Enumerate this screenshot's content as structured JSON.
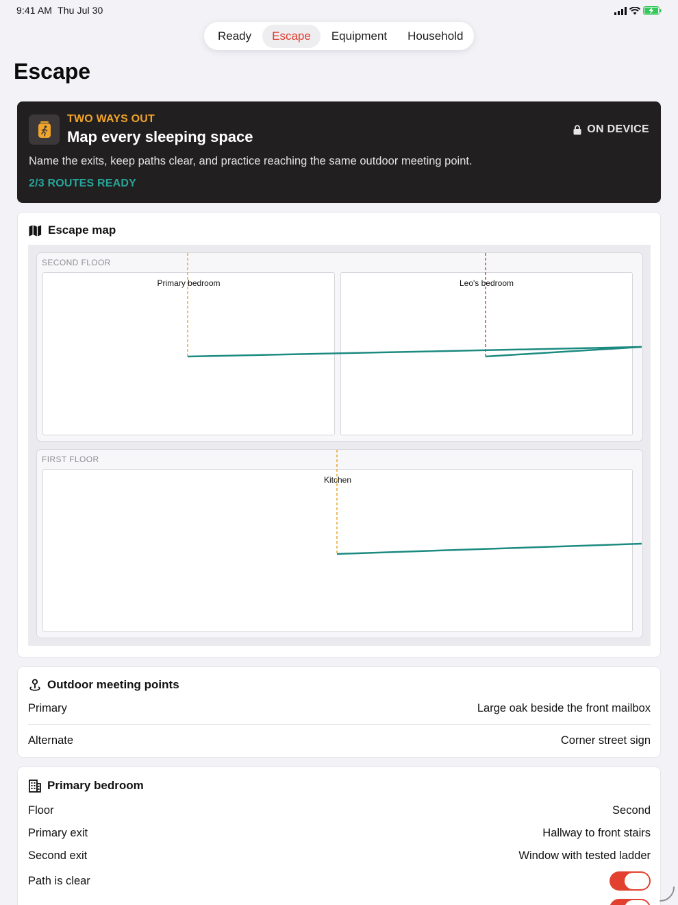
{
  "status": {
    "time": "9:41 AM",
    "date": "Thu Jul 30"
  },
  "tabs": [
    {
      "label": "Ready",
      "active": false
    },
    {
      "label": "Escape",
      "active": true
    },
    {
      "label": "Equipment",
      "active": false
    },
    {
      "label": "Household",
      "active": false
    }
  ],
  "page_title": "Escape",
  "hero": {
    "eyebrow": "TWO WAYS OUT",
    "title": "Map every sleeping space",
    "badge": "ON DEVICE",
    "description": "Name the exits, keep paths clear, and practice reaching the same outdoor meeting point.",
    "status": "2/3 ROUTES READY",
    "icon": "running-person-icon",
    "accent_color": "#f0a42a",
    "status_color": "#26a69a"
  },
  "escape_map": {
    "title": "Escape map",
    "icon": "map-icon",
    "floors": [
      {
        "label": "SECOND FLOOR",
        "rooms": [
          {
            "name": "Primary bedroom"
          },
          {
            "name": "Leo's bedroom"
          }
        ]
      },
      {
        "label": "FIRST FLOOR",
        "rooms": [
          {
            "name": "Kitchen"
          }
        ]
      }
    ],
    "colors": {
      "route": "#1b8a80",
      "exit_ready": "#e8a531",
      "exit_unready": "#d9423a"
    }
  },
  "meeting_points": {
    "title": "Outdoor meeting points",
    "icon": "location-pin-icon",
    "rows": [
      {
        "label": "Primary",
        "value": "Large oak beside the front mailbox"
      },
      {
        "label": "Alternate",
        "value": "Corner street sign"
      }
    ]
  },
  "room_detail": {
    "title": "Primary bedroom",
    "icon": "building-icon",
    "rows": [
      {
        "label": "Floor",
        "value": "Second"
      },
      {
        "label": "Primary exit",
        "value": "Hallway to front stairs"
      },
      {
        "label": "Second exit",
        "value": "Window with tested ladder"
      }
    ],
    "toggle": {
      "label": "Path is clear",
      "on": true
    },
    "toggle_color": "#e2412f"
  }
}
